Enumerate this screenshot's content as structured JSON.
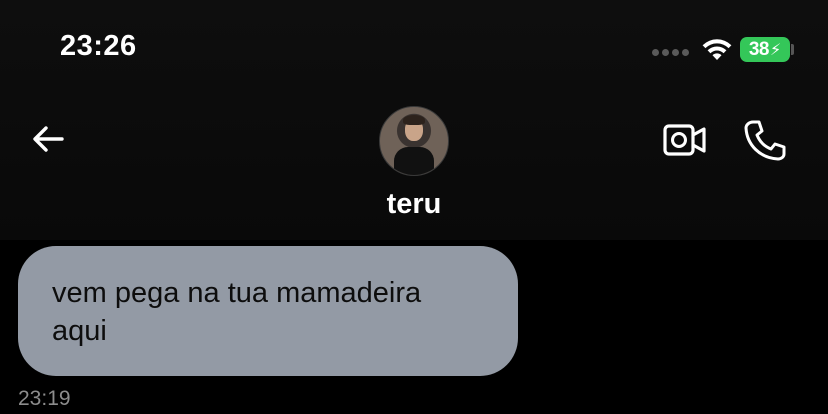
{
  "status_bar": {
    "time": "23:26",
    "battery_level": "38",
    "battery_charging": "⚡",
    "battery_color": "#34c759",
    "icons": [
      "signal-dots-icon",
      "wifi-icon",
      "battery-icon"
    ]
  },
  "header": {
    "back_icon": "arrow-left-icon",
    "contact_name": "teru",
    "avatar_icon": "profile-photo",
    "video_call_icon": "video-camera-icon",
    "voice_call_icon": "phone-icon"
  },
  "messages": [
    {
      "direction": "received",
      "text": "vem pega na tua mamadeira aqui",
      "time": "23:19",
      "bubble_color": "#939aa5"
    }
  ]
}
